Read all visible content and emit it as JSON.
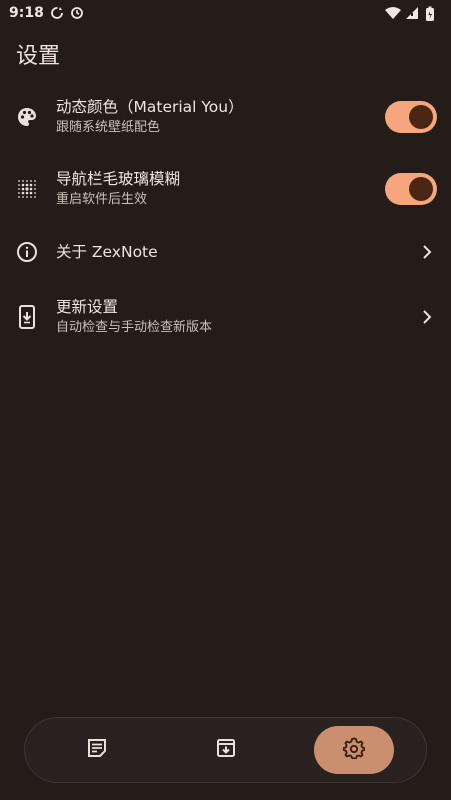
{
  "status_bar": {
    "time": "9:18",
    "left_icons": [
      "sync-icon",
      "refresh-icon"
    ],
    "right_icons": [
      "wifi-icon",
      "signal-icon",
      "battery-icon"
    ]
  },
  "page": {
    "title": "设置"
  },
  "settings": [
    {
      "icon": "palette-icon",
      "title": "动态颜色（Material You）",
      "subtitle": "跟随系统壁纸配色",
      "control": "toggle",
      "toggle_on": true
    },
    {
      "icon": "blur-icon",
      "title": "导航栏毛玻璃模糊",
      "subtitle": "重启软件后生效",
      "control": "toggle",
      "toggle_on": true
    },
    {
      "icon": "info-icon",
      "title": "关于 ZexNote",
      "subtitle": "",
      "control": "chevron"
    },
    {
      "icon": "system-update-icon",
      "title": "更新设置",
      "subtitle": "自动检查与手动检查新版本",
      "control": "chevron"
    }
  ],
  "bottom_nav": {
    "items": [
      {
        "icon": "note-icon",
        "active": false
      },
      {
        "icon": "archive-icon",
        "active": false
      },
      {
        "icon": "settings-icon",
        "active": true
      }
    ]
  },
  "colors": {
    "background": "#231c19",
    "toggle_track": "#f5a67c",
    "toggle_knob": "#4b2613",
    "nav_active": "#c98f6e"
  }
}
